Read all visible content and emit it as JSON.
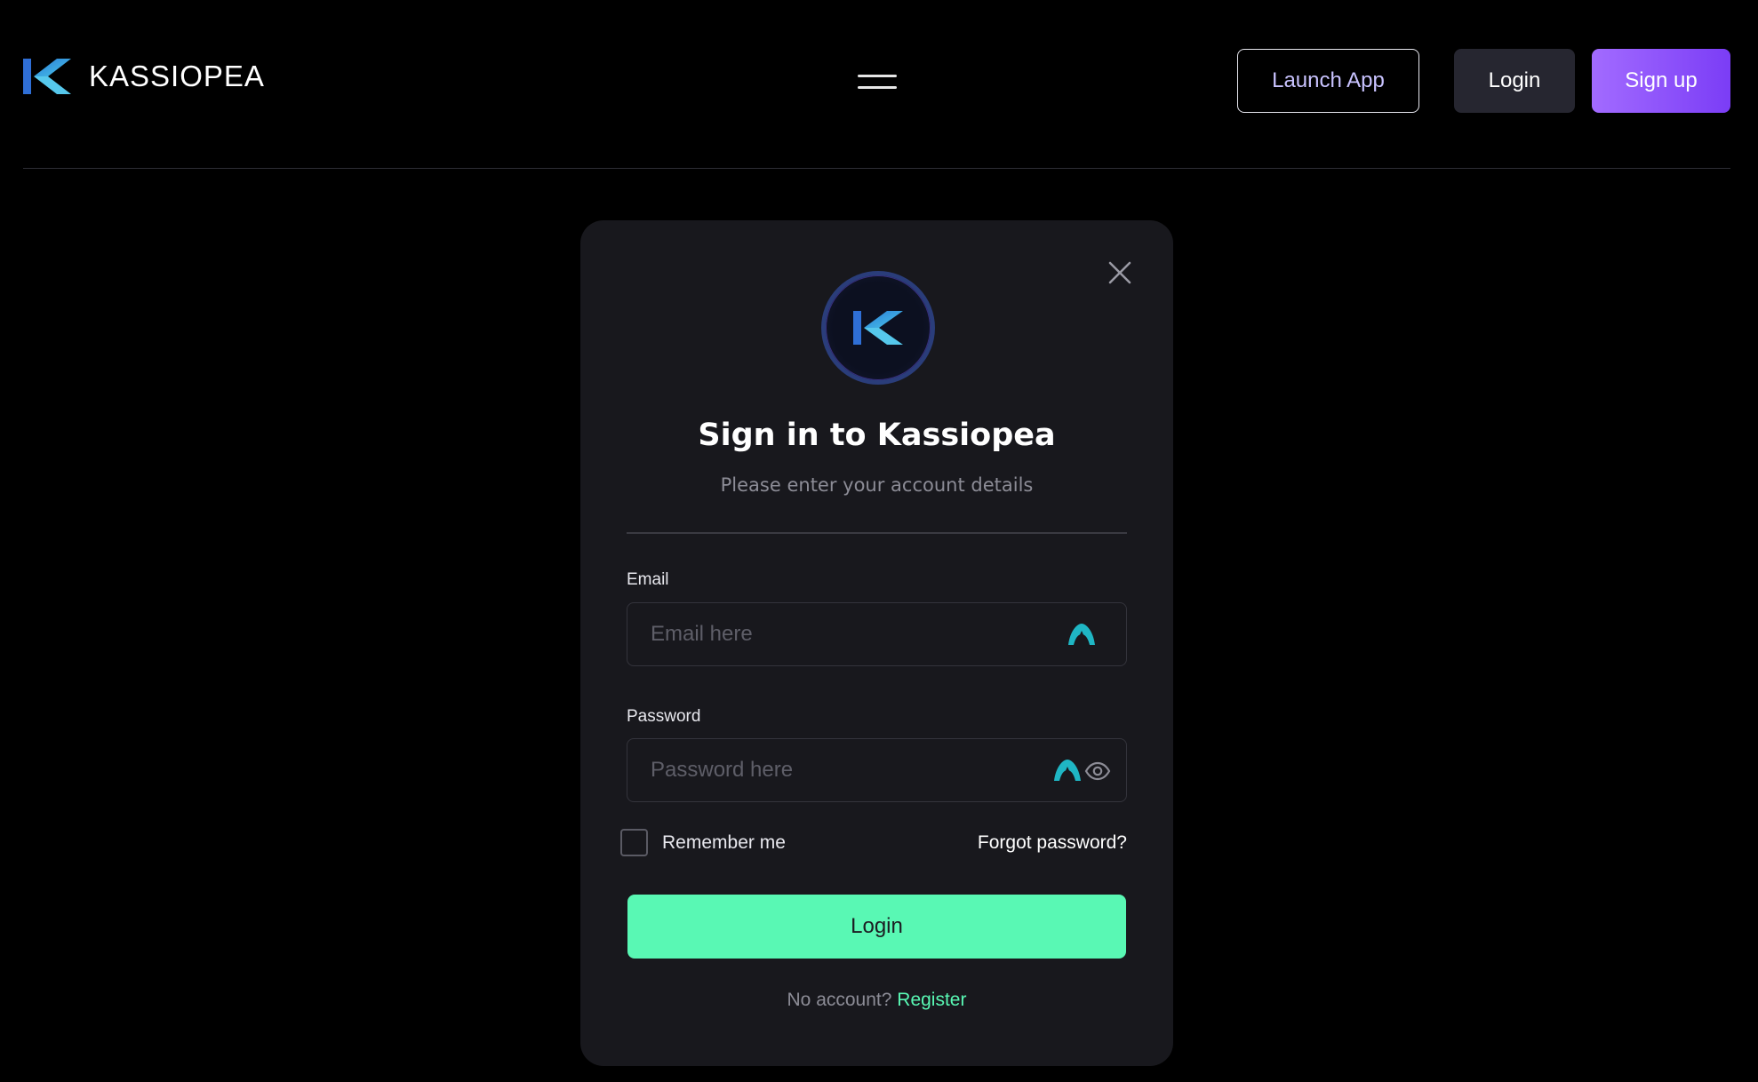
{
  "header": {
    "brand": "KASSIOPEA",
    "logo_icon": "kassiopea-k-logo",
    "menu_icon": "hamburger-menu-icon",
    "launch_label": "Launch App",
    "login_label": "Login",
    "signup_label": "Sign up"
  },
  "modal": {
    "close_icon": "close-icon",
    "title": "Sign in to Kassiopea",
    "subtitle": "Please enter your account details",
    "email": {
      "label": "Email",
      "placeholder": "Email here",
      "value": ""
    },
    "password": {
      "label": "Password",
      "placeholder": "Password here",
      "value": ""
    },
    "remember_label": "Remember me",
    "remember_checked": false,
    "forgot_label": "Forgot password?",
    "login_label": "Login",
    "no_account_text": "No account?",
    "register_label": "Register"
  },
  "colors": {
    "background": "#000000",
    "modal_bg": "#18181d",
    "accent_green": "#59f8b4",
    "accent_purple": "#8b4cf7",
    "logo_blue": "#3b8df0"
  }
}
